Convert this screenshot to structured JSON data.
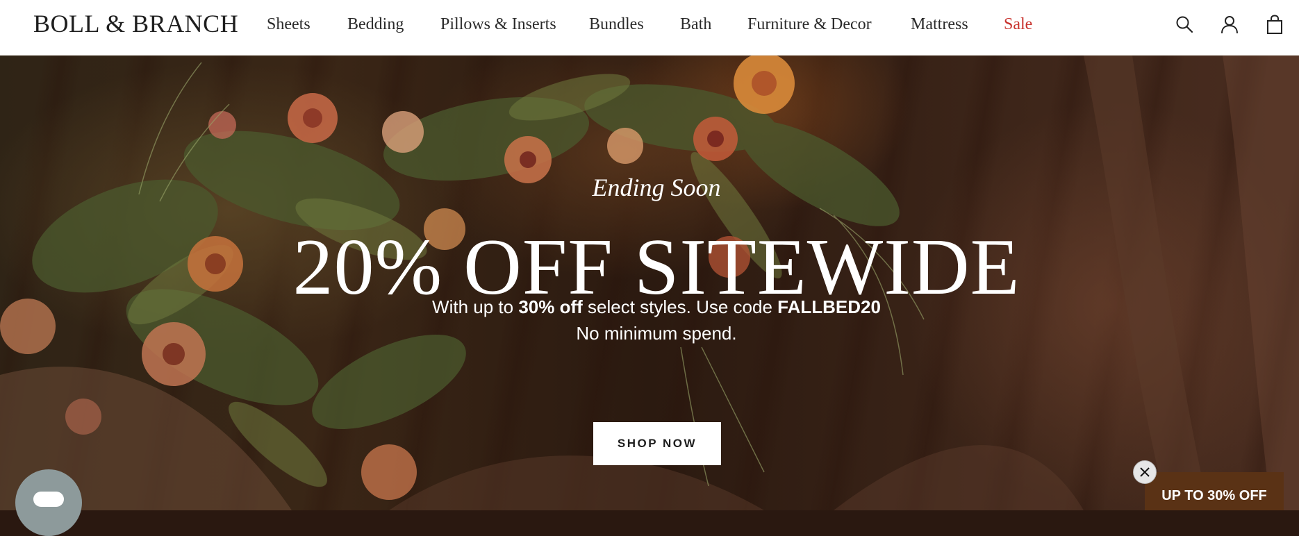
{
  "header": {
    "logo": "BOLL & BRANCH",
    "nav": [
      {
        "label": "Sheets"
      },
      {
        "label": "Bedding"
      },
      {
        "label": "Pillows & Inserts"
      },
      {
        "label": "Bundles"
      },
      {
        "label": "Bath"
      },
      {
        "label": "Furniture & Decor"
      },
      {
        "label": "Mattress"
      },
      {
        "label": "Sale"
      }
    ],
    "icons": [
      "search-icon",
      "account-icon",
      "bag-icon"
    ]
  },
  "hero": {
    "eyebrow": "Ending Soon",
    "headline": "20% OFF SITEWIDE",
    "sub_line1_a": "With up to ",
    "sub_line1_b": "30% off",
    "sub_line1_c": " select styles. Use code ",
    "sub_line1_d": "FALLBED20",
    "sub_line2": "No minimum spend.",
    "cta": "SHOP NOW"
  },
  "promo": {
    "label": "UP TO 30% OFF"
  },
  "colors": {
    "sale": "#c8322d",
    "promo_bg": "#5a3215",
    "chat_bg": "#8d9a9b"
  }
}
